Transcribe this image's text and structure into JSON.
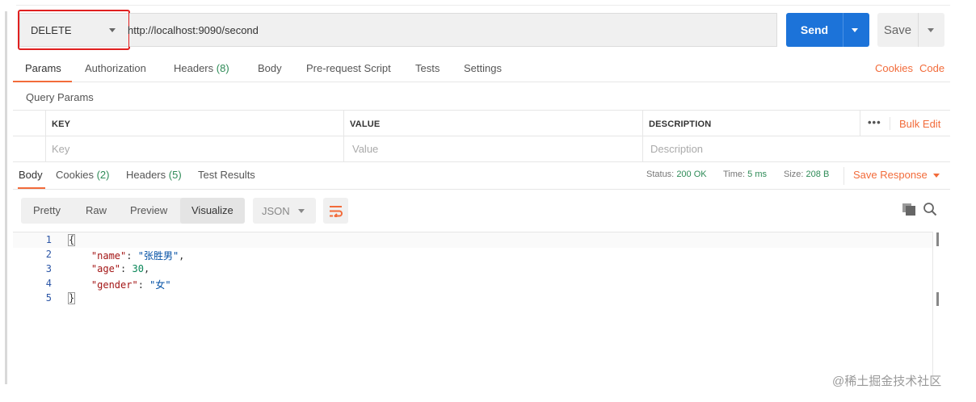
{
  "request": {
    "method": "DELETE",
    "url": "http://localhost:9090/second",
    "send_label": "Send",
    "save_label": "Save"
  },
  "request_tabs": {
    "params": "Params",
    "authorization": "Authorization",
    "headers": "Headers",
    "headers_count": "(8)",
    "body": "Body",
    "prerequest": "Pre-request Script",
    "tests": "Tests",
    "settings": "Settings",
    "cookies": "Cookies",
    "code": "Code"
  },
  "query_params": {
    "title": "Query Params",
    "columns": {
      "key": "KEY",
      "value": "VALUE",
      "description": "DESCRIPTION"
    },
    "dots": "•••",
    "bulk_edit": "Bulk Edit",
    "placeholders": {
      "key": "Key",
      "value": "Value",
      "description": "Description"
    }
  },
  "response_tabs": {
    "body": "Body",
    "cookies": "Cookies",
    "cookies_count": "(2)",
    "headers": "Headers",
    "headers_count": "(5)",
    "test_results": "Test Results"
  },
  "response_meta": {
    "status_label": "Status:",
    "status_value": "200 OK",
    "time_label": "Time:",
    "time_value": "5 ms",
    "size_label": "Size:",
    "size_value": "208 B",
    "save_response": "Save Response"
  },
  "view_modes": {
    "pretty": "Pretty",
    "raw": "Raw",
    "preview": "Preview",
    "visualize": "Visualize",
    "format": "JSON"
  },
  "code": {
    "line_numbers": [
      "1",
      "2",
      "3",
      "4",
      "5"
    ],
    "open_brace": "{",
    "close_brace": "}",
    "key1": "\"name\"",
    "val1": "\"张胜男\"",
    "key2": "\"age\"",
    "val2": "30",
    "key3": "\"gender\"",
    "val3": "\"女\""
  },
  "watermark": "@稀土掘金技术社区",
  "colors": {
    "accent": "#f26b3a",
    "send": "#1c73d9",
    "ok": "#2e8b57",
    "highlight": "#e02020"
  }
}
